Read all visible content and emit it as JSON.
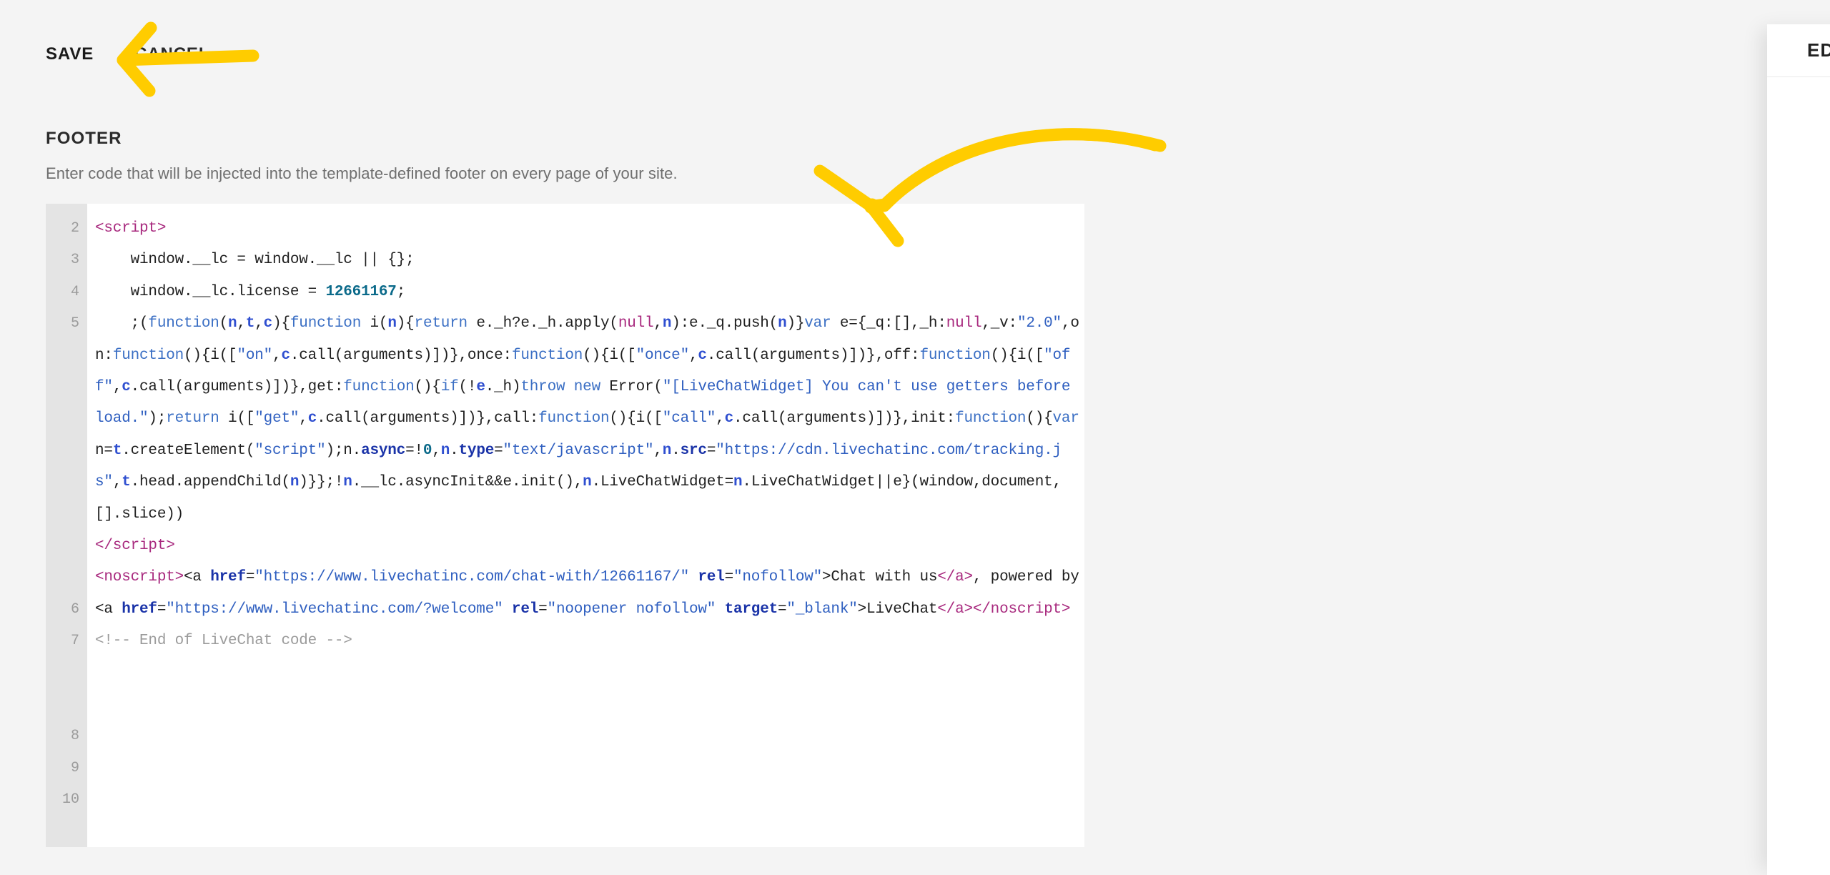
{
  "toolbar": {
    "save_label": "SAVE",
    "cancel_label": "CANCEL"
  },
  "section": {
    "title": "FOOTER",
    "description": "Enter code that will be injected into the template-defined footer on every page of your site."
  },
  "editor": {
    "line_numbers": [
      "2",
      "3",
      "4",
      "5",
      "6",
      "7",
      "8",
      "9",
      "10"
    ],
    "lines": [
      {
        "n": "2",
        "text": "<script>"
      },
      {
        "n": "3",
        "text": "    window.__lc = window.__lc || {};"
      },
      {
        "n": "4",
        "text": "    window.__lc.license = 12661167;"
      },
      {
        "n": "5",
        "text": "    ;(function(n,t,c){function i(n){return e._h?e._h.apply(null,n):e._q.push(n)}var e={_q:[],_h:null,_v:\"2.0\",on:function(){i([\"on\",c.call(arguments)])},once:function(){i([\"once\",c.call(arguments)])},off:function(){i([\"off\",c.call(arguments)])},get:function(){if(!e._h)throw new Error(\"[LiveChatWidget] You can't use getters before load.\");return i([\"get\",c.call(arguments)])},call:function(){i([\"call\",c.call(arguments)])},init:function(){var n=t.createElement(\"script\");n.async=!0,n.type=\"text/javascript\",n.src=\"https://cdn.livechatinc.com/tracking.js\",t.head.appendChild(n)}};!n.__lc.asyncInit&&e.init(),n.LiveChatWidget=n.LiveChatWidget||e}(window,document,[].slice))"
      },
      {
        "n": "6",
        "text": "</script>"
      },
      {
        "n": "7",
        "text": "<noscript><a href=\"https://www.livechatinc.com/chat-with/12661167/\" rel=\"nofollow\">Chat with us</a>, powered by <a href=\"https://www.livechatinc.com/?welcome\" rel=\"noopener nofollow\" target=\"_blank\">LiveChat</a></noscript>"
      },
      {
        "n": "8",
        "text": "<!-- End of LiveChat code -->"
      },
      {
        "n": "9",
        "text": ""
      },
      {
        "n": "10",
        "text": ""
      }
    ],
    "license_id": "12661167",
    "version": "2.0",
    "tracking_url": "https://cdn.livechatinc.com/tracking.js",
    "chat_with_url": "https://www.livechatinc.com/chat-with/12661167/",
    "welcome_url": "https://www.livechatinc.com/?welcome",
    "comment": "<!-- End of LiveChat code -->"
  },
  "right_panel": {
    "title": "EDIT"
  },
  "annotations": {
    "arrow_cancel_name": "arrow-pointing-to-cancel",
    "arrow_editor_name": "arrow-pointing-to-code-editor",
    "color": "#ffcc00"
  },
  "colors": {
    "page_bg": "#f4f4f4",
    "editor_bg": "#ffffff",
    "gutter_bg": "#e4e4e4",
    "tag": "#a8297e",
    "keyword": "#3b6fc4",
    "string": "#2f5fc0",
    "number": "#0b6a8a",
    "attribute": "#1a33a8",
    "comment": "#9b9b9b",
    "annotation": "#ffcc00"
  }
}
